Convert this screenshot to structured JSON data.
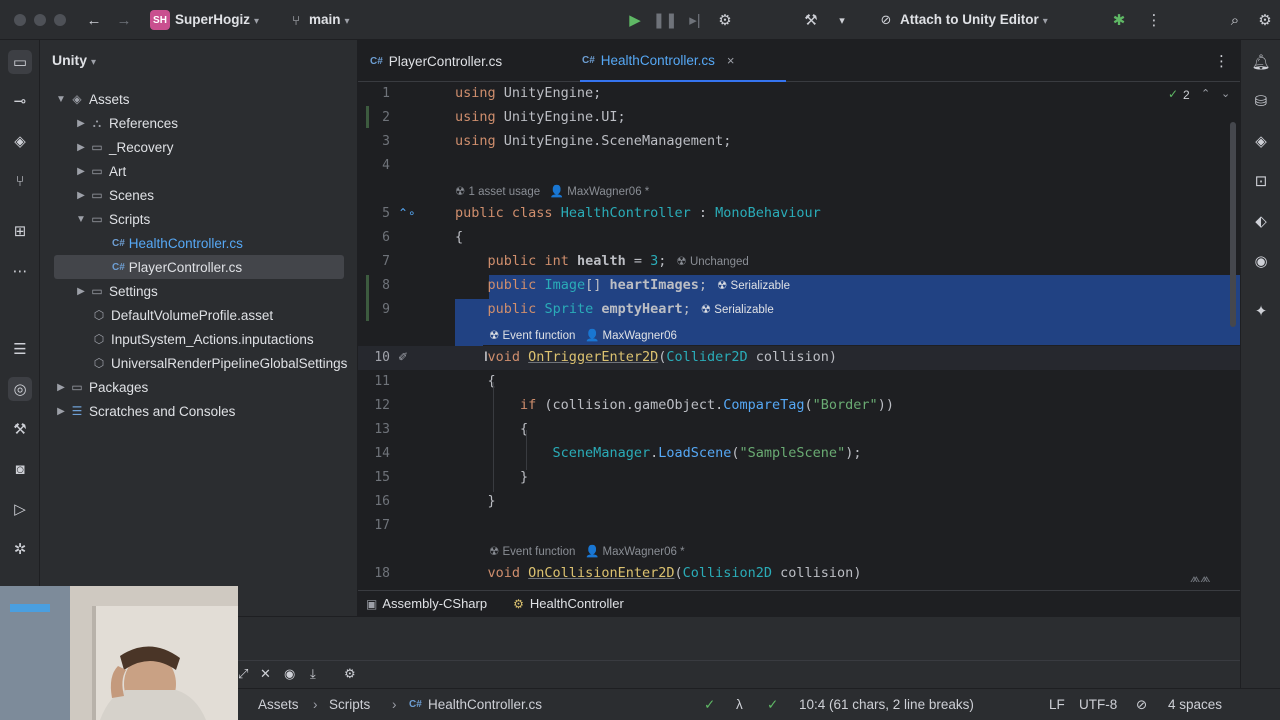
{
  "titlebar": {
    "project_badge": "SH",
    "project_name": "SuperHogiz",
    "branch": "main",
    "attach_label": "Attach to Unity Editor"
  },
  "project_panel": {
    "title": "Unity",
    "tree": [
      {
        "label": "Assets",
        "icon": "folder-icon"
      },
      {
        "label": "References",
        "icon": "references-icon"
      },
      {
        "label": "_Recovery",
        "icon": "folder-icon"
      },
      {
        "label": "Art",
        "icon": "folder-icon"
      },
      {
        "label": "Scenes",
        "icon": "folder-icon"
      },
      {
        "label": "Scripts",
        "icon": "folder-icon"
      },
      {
        "label": "HealthController.cs",
        "icon": "csharp-file-icon"
      },
      {
        "label": "PlayerController.cs",
        "icon": "csharp-file-icon"
      },
      {
        "label": "Settings",
        "icon": "folder-icon"
      },
      {
        "label": "DefaultVolumeProfile.asset",
        "icon": "asset-icon"
      },
      {
        "label": "InputSystem_Actions.inputactions",
        "icon": "asset-icon"
      },
      {
        "label": "UniversalRenderPipelineGlobalSettings",
        "icon": "asset-icon"
      },
      {
        "label": "Packages",
        "icon": "folder-icon"
      },
      {
        "label": "Scratches and Consoles",
        "icon": "scratches-icon"
      }
    ],
    "cs_badge": "C#"
  },
  "tabs": [
    {
      "label": "PlayerController.cs",
      "active": false
    },
    {
      "label": "HealthController.cs",
      "active": true
    }
  ],
  "editor": {
    "problems_count": "2",
    "hints": {
      "asset_usage": "1 asset usage",
      "author": "MaxWagner06",
      "author_star": "MaxWagner06 *",
      "unchanged": "Unchanged",
      "serializable": "Serializable",
      "event_function": "Event function"
    },
    "line_numbers": [
      "1",
      "2",
      "3",
      "4",
      "5",
      "6",
      "7",
      "8",
      "9",
      "10",
      "11",
      "12",
      "13",
      "14",
      "15",
      "16",
      "17",
      "18"
    ],
    "code": {
      "l1_kw": "using",
      "l1_rest": " UnityEngine;",
      "l2_kw": "using",
      "l2_rest": " UnityEngine.UI;",
      "l3_kw": "using",
      "l3_rest": " UnityEngine.SceneManagement;",
      "l5_kw1": "public",
      "l5_kw2": "class",
      "l5_name": "HealthController",
      "l5_colon": " : ",
      "l5_base": "MonoBehaviour",
      "l6": "{",
      "l7_kw1": "public",
      "l7_kw2": "int",
      "l7_var": "health",
      "l7_eq": " = ",
      "l7_num": "3",
      "l7_end": ";",
      "l8_kw1": "public",
      "l8_type": "Image",
      "l8_br": "[] ",
      "l8_var": "heartImages",
      "l8_end": ";",
      "l9_kw1": "public",
      "l9_type": "Sprite",
      "l9_var": "emptyHeart",
      "l9_end": ";",
      "l10_kw": "void",
      "l10_fn": "OnTriggerEnter2D",
      "l10_open": "(",
      "l10_type": "Collider2D",
      "l10_param": " collision",
      "l10_close": ")",
      "l11": "{",
      "l12_kw": "if",
      "l12_a": " (collision.gameObject.",
      "l12_fn": "CompareTag",
      "l12_b": "(",
      "l12_str": "\"Border\"",
      "l12_c": "))",
      "l13": "{",
      "l14_cls": "SceneManager",
      "l14_dot": ".",
      "l14_fn": "LoadScene",
      "l14_a": "(",
      "l14_str": "\"SampleScene\"",
      "l14_b": ");",
      "l15": "}",
      "l16": "}",
      "l18_kw": "void",
      "l18_fn": "OnCollisionEnter2D",
      "l18_open": "(",
      "l18_type": "Collision2D",
      "l18_param": " collision",
      "l18_close": ")"
    }
  },
  "breadcrumbs_editor": {
    "assembly": "Assembly-CSharp",
    "class": "HealthController"
  },
  "statusbar": {
    "path": [
      "Assets",
      "Scripts",
      "HealthController.cs"
    ],
    "position": "10:4 (61 chars, 2 line breaks)",
    "line_ending": "LF",
    "encoding": "UTF-8",
    "indent": "4 spaces"
  },
  "colors": {
    "accent": "#3574f0",
    "selection": "#214283",
    "keyword": "#cf8e6d",
    "type": "#2aacb8",
    "method": "#56a8f5",
    "string": "#6aab73"
  }
}
